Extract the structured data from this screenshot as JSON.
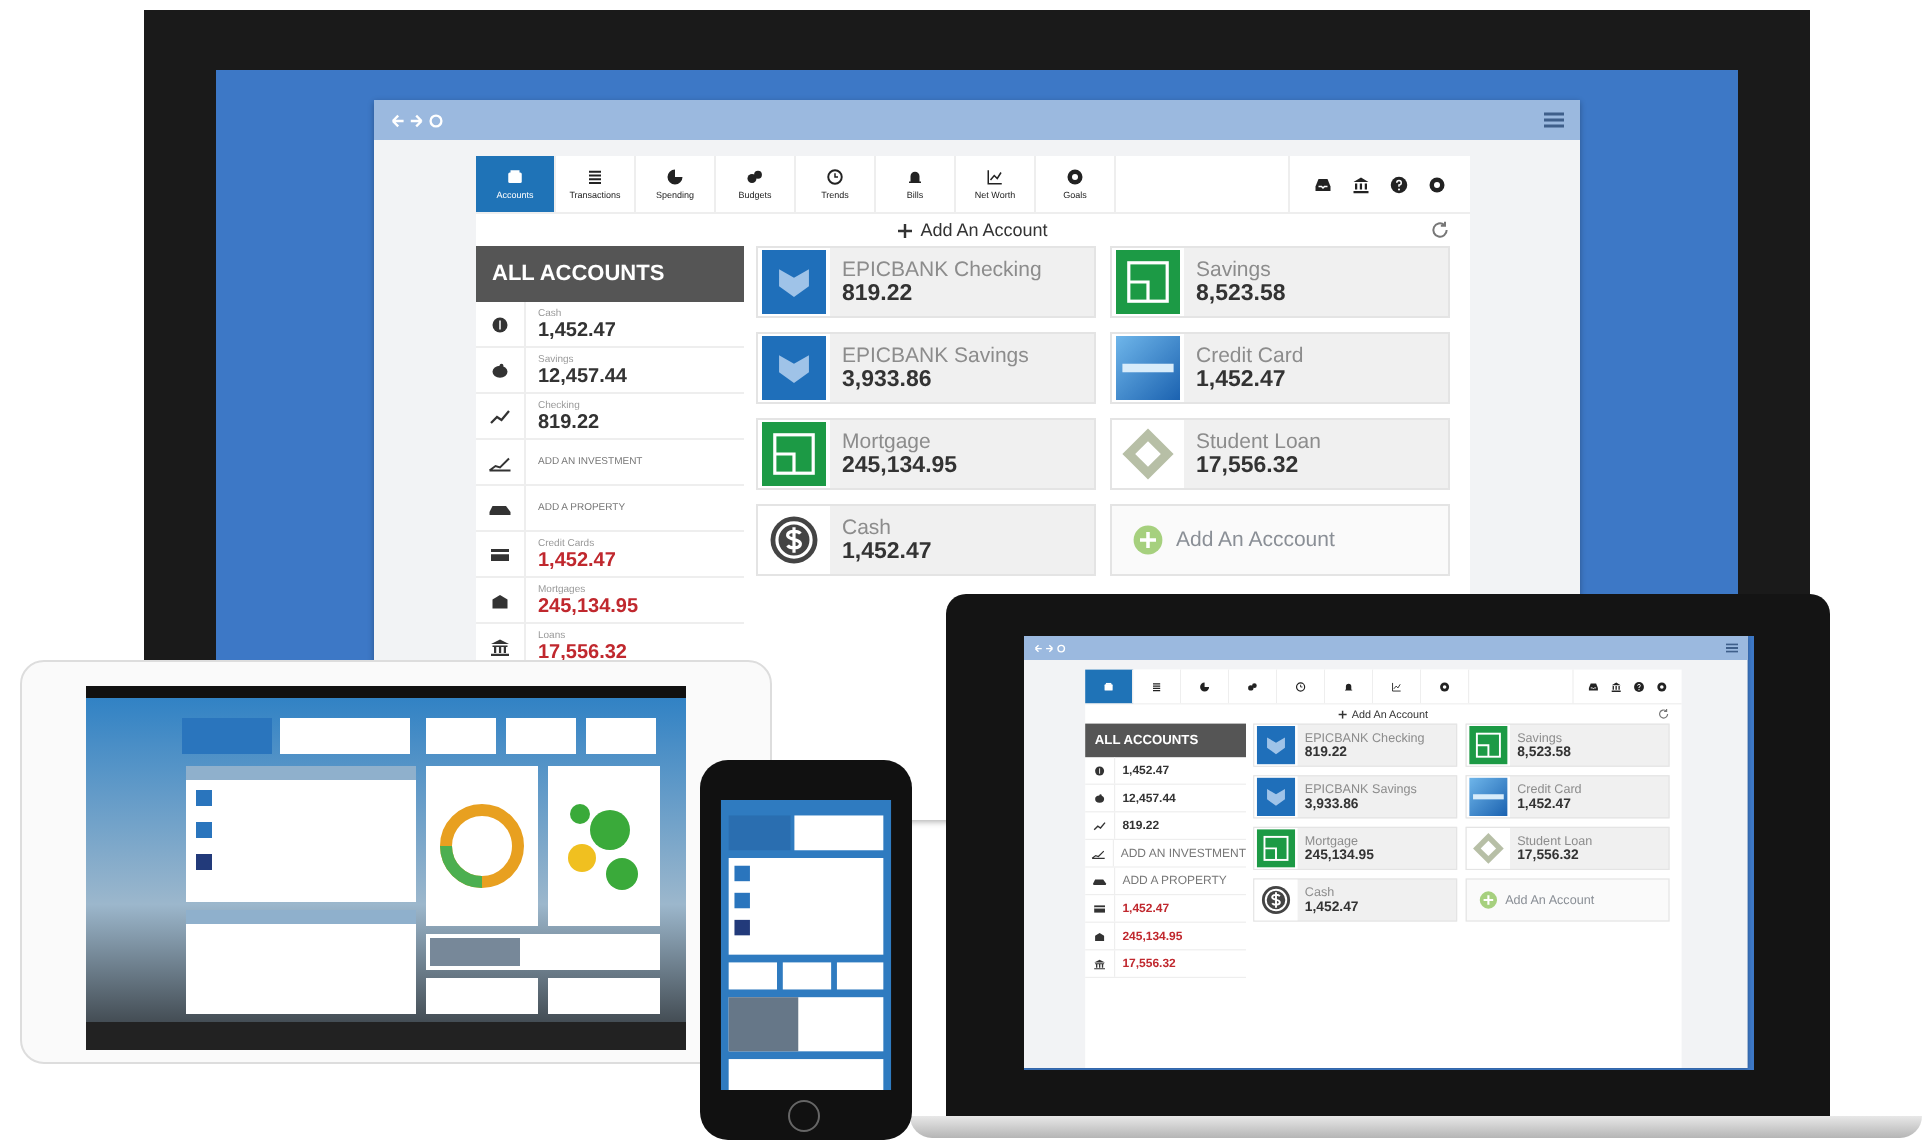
{
  "monitor_app": {
    "tabs": [
      {
        "label": "Accounts",
        "selected": true
      },
      {
        "label": "Transactions",
        "selected": false
      },
      {
        "label": "Spending",
        "selected": false
      },
      {
        "label": "Budgets",
        "selected": false
      },
      {
        "label": "Trends",
        "selected": false
      },
      {
        "label": "Bills",
        "selected": false
      },
      {
        "label": "Net Worth",
        "selected": false
      },
      {
        "label": "Goals",
        "selected": false
      }
    ],
    "add_account_link": "Add An Account",
    "sidebar": {
      "title": "ALL ACCOUNTS",
      "items": [
        {
          "kind": "balance",
          "label": "Cash",
          "amount": "1,452.47",
          "debt": false
        },
        {
          "kind": "balance",
          "label": "Savings",
          "amount": "12,457.44",
          "debt": false
        },
        {
          "kind": "balance",
          "label": "Checking",
          "amount": "819.22",
          "debt": false
        },
        {
          "kind": "action",
          "label": "ADD AN INVESTMENT"
        },
        {
          "kind": "action",
          "label": "ADD A PROPERTY"
        },
        {
          "kind": "balance",
          "label": "Credit Cards",
          "amount": "1,452.47",
          "debt": true
        },
        {
          "kind": "balance",
          "label": "Mortgages",
          "amount": "245,134.95",
          "debt": true
        },
        {
          "kind": "balance",
          "label": "Loans",
          "amount": "17,556.32",
          "debt": true
        }
      ]
    },
    "cards": [
      {
        "kind": "bank",
        "name": "EPICBANK Checking",
        "amount": "819.22"
      },
      {
        "kind": "savings",
        "name": "Savings",
        "amount": "8,523.58"
      },
      {
        "kind": "bank",
        "name": "EPICBANK Savings",
        "amount": "3,933.86"
      },
      {
        "kind": "card",
        "name": "Credit Card",
        "amount": "1,452.47"
      },
      {
        "kind": "savings",
        "name": "Mortgage",
        "amount": "245,134.95"
      },
      {
        "kind": "loan",
        "name": "Student Loan",
        "amount": "17,556.32"
      },
      {
        "kind": "cash",
        "name": "Cash",
        "amount": "1,452.47"
      },
      {
        "kind": "add",
        "name": "Add An Acccount"
      }
    ]
  },
  "laptop_app": {
    "tabs": [
      {
        "selected": true
      },
      {
        "selected": false
      },
      {
        "selected": false
      },
      {
        "selected": false
      },
      {
        "selected": false
      },
      {
        "selected": false
      },
      {
        "selected": false
      },
      {
        "selected": false
      }
    ],
    "add_account_link": "Add An Account",
    "sidebar": {
      "title": "ALL ACCOUNTS",
      "items": [
        {
          "kind": "balance",
          "amount": "1,452.47",
          "debt": false
        },
        {
          "kind": "balance",
          "amount": "12,457.44",
          "debt": false
        },
        {
          "kind": "balance",
          "amount": "819.22",
          "debt": false
        },
        {
          "kind": "action",
          "label": "ADD AN INVESTMENT"
        },
        {
          "kind": "action",
          "label": "ADD A PROPERTY"
        },
        {
          "kind": "balance",
          "amount": "1,452.47",
          "debt": true
        },
        {
          "kind": "balance",
          "amount": "245,134.95",
          "debt": true
        },
        {
          "kind": "balance",
          "amount": "17,556.32",
          "debt": true
        }
      ]
    },
    "cards": [
      {
        "kind": "bank",
        "name": "EPICBANK Checking",
        "amount": "819.22"
      },
      {
        "kind": "savings",
        "name": "Savings",
        "amount": "8,523.58"
      },
      {
        "kind": "bank",
        "name": "EPICBANK Savings",
        "amount": "3,933.86"
      },
      {
        "kind": "card",
        "name": "Credit Card",
        "amount": "1,452.47"
      },
      {
        "kind": "savings",
        "name": "Mortgage",
        "amount": "245,134.95"
      },
      {
        "kind": "loan",
        "name": "Student Loan",
        "amount": "17,556.32"
      },
      {
        "kind": "cash",
        "name": "Cash",
        "amount": "1,452.47"
      },
      {
        "kind": "add",
        "name": "Add An Account"
      }
    ]
  }
}
